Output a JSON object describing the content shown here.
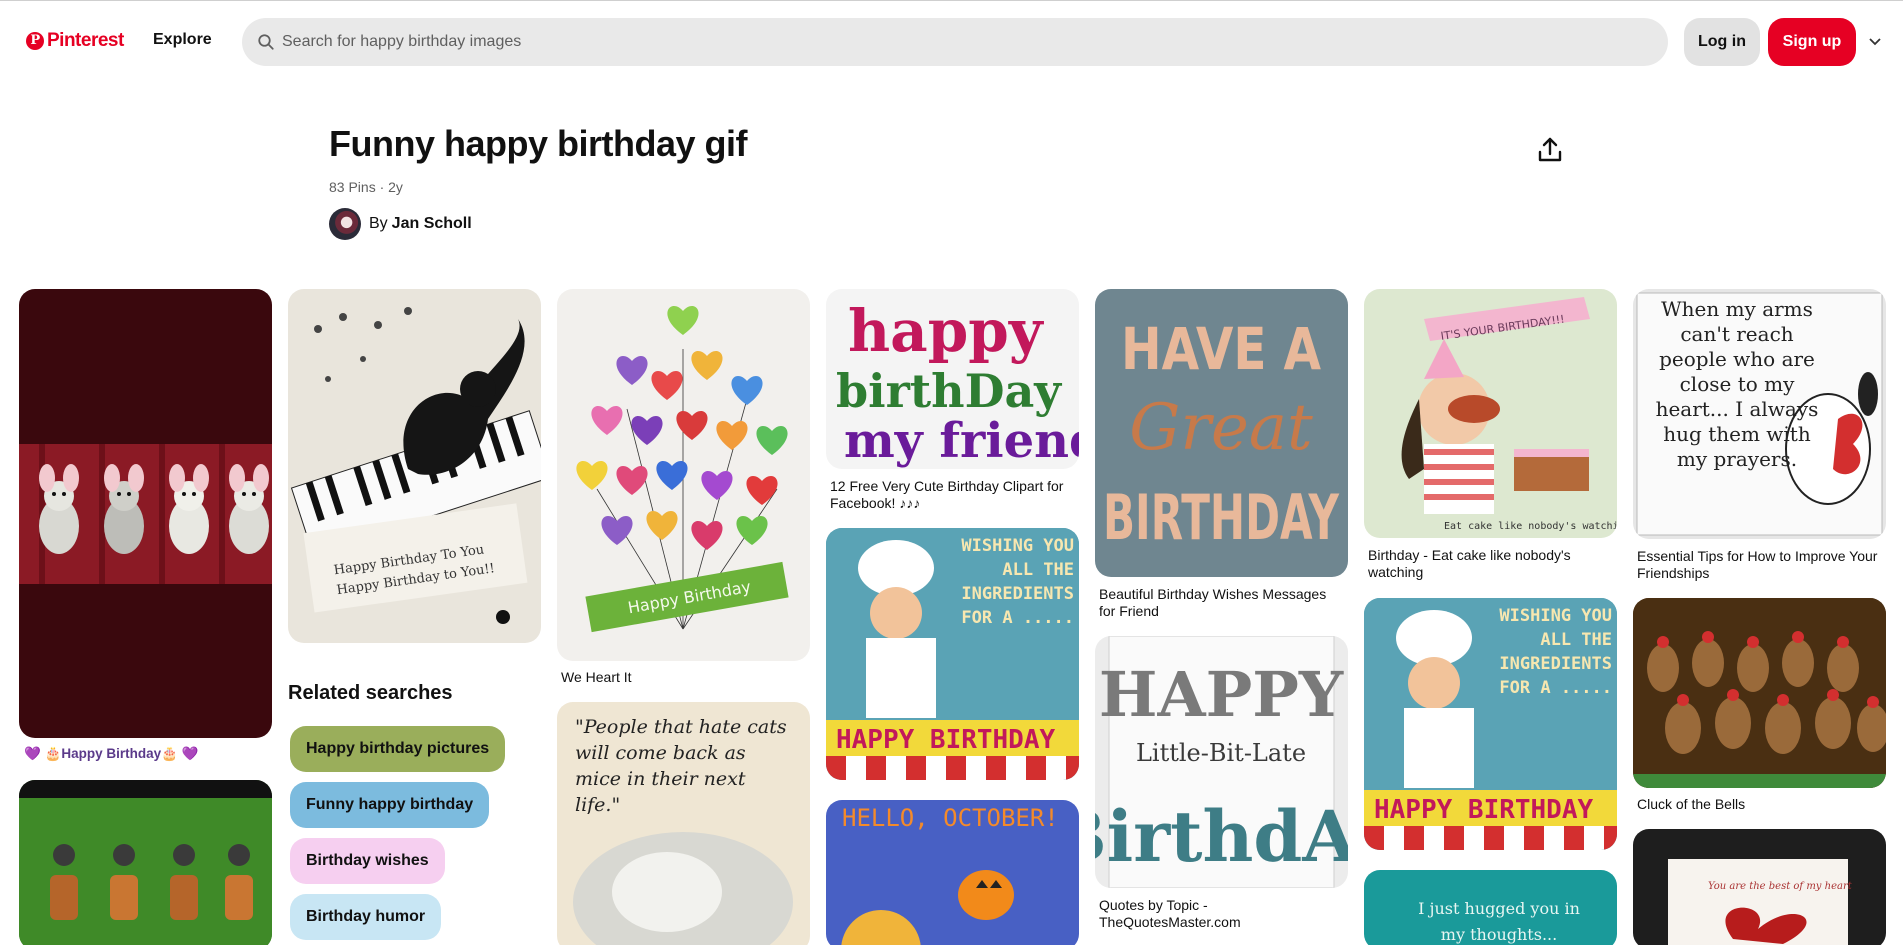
{
  "header": {
    "logo_text": "Pinterest",
    "explore_label": "Explore",
    "search_placeholder": "Search for happy birthday images",
    "login_label": "Log in",
    "signup_label": "Sign up"
  },
  "board": {
    "title": "Funny happy birthday gif",
    "meta": "83 Pins · 2y",
    "by_prefix": "By",
    "owner_name": "Jan Scholl"
  },
  "related": {
    "title": "Related searches",
    "chips": [
      {
        "label": "Happy birthday pictures",
        "color": "#9aae5b"
      },
      {
        "label": "Funny happy birthday",
        "color": "#7cbbde"
      },
      {
        "label": "Birthday wishes",
        "color": "#f6cff0"
      },
      {
        "label": "Birthday humor",
        "color": "#c8e6f4"
      }
    ]
  },
  "pins": {
    "mice": {
      "caption": "💜 🎂Happy Birthday🎂 💜"
    },
    "hearts": {
      "caption": "We Heart It",
      "ribbon_text": "Happy Birthday"
    },
    "cat_piano": {
      "sheet_text_1": "Happy Birthday To You",
      "sheet_text_2": "Happy Birthday to You!!"
    },
    "happy_friend": {
      "art_line_1": "happy",
      "art_line_2": "birthDay",
      "art_line_3": "my friend",
      "caption": "12 Free Very Cute Birthday Clipart for Facebook! ♪♪♪"
    },
    "great_birthday": {
      "art_line_1": "HAVE A",
      "art_line_2": "Great",
      "art_line_3": "BIRTHDAY",
      "caption": "Beautiful Birthday Wishes Messages for Friend"
    },
    "chef_1": {
      "art_text": "WISHING YOU ALL THE INGREDIENTS FOR A .....",
      "banner": "HAPPY BIRTHDAY"
    },
    "chef_2": {
      "art_text": "WISHING YOU ALL THE INGREDIENTS FOR A .....",
      "banner": "HAPPY BIRTHDAY"
    },
    "eat_cake": {
      "banner": "IT'S YOUR BIRTHDAY!!!",
      "footer": "Eat cake like nobody's watching",
      "caption": "Birthday - Eat cake like nobody's watching"
    },
    "snoopy": {
      "quote": "When my arms can't reach people who are close to my heart... I always hug them with my prayers.",
      "caption": "Essential Tips for How to Improve Your Friendships"
    },
    "little_late": {
      "art_line_1": "HAPPY",
      "art_line_2": "Little-Bit-Late",
      "art_line_3": "BirthdAy",
      "caption": "Quotes by Topic - TheQuotesMaster.com"
    },
    "chickens": {
      "caption": "Cluck of the Bells"
    },
    "cats_quote": {
      "quote": "\"People that hate cats will come back as mice in their next life.\""
    },
    "october": {
      "art_text": "HELLO, OCTOBER!"
    },
    "hugged": {
      "art_text": "I just hugged you in my thoughts..."
    },
    "bow_card": {
      "art_text": "You are the best of my heart"
    }
  }
}
